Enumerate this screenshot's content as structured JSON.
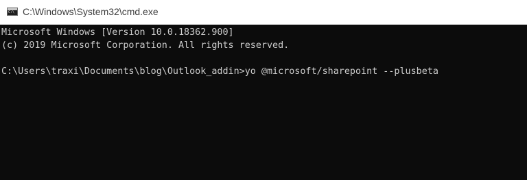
{
  "window": {
    "title": "C:\\Windows\\System32\\cmd.exe",
    "icon": "cmd-app-icon"
  },
  "console": {
    "lines": [
      "Microsoft Windows [Version 10.0.18362.900]",
      "(c) 2019 Microsoft Corporation. All rights reserved.",
      "",
      "C:\\Users\\traxi\\Documents\\blog\\Outlook_addin>yo @microsoft/sharepoint --plusbeta"
    ],
    "text_color": "#cccccc",
    "background_color": "#0c0c0c"
  }
}
